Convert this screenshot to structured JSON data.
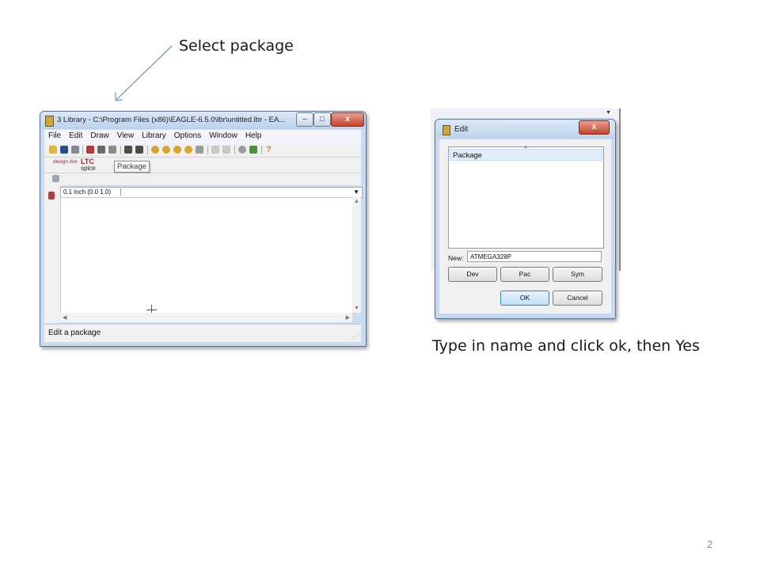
{
  "slide": {
    "caption_top": "Select package",
    "caption_right": "Type in name and click ok, then Yes",
    "page_number": "2"
  },
  "eagle_window": {
    "title": "3 Library - C:\\Program Files (x86)\\EAGLE-6.5.0\\lbr\\untitled.lbr - EA...",
    "controls": {
      "minimize": "–",
      "maximize": "□",
      "close": "x"
    },
    "menu": [
      "File",
      "Edit",
      "Draw",
      "View",
      "Library",
      "Options",
      "Window",
      "Help"
    ],
    "toolbar_logo_design": "design link",
    "toolbar_logo_ltc": "LTC",
    "toolbar_logo_ltc_sub": "spice",
    "tooltip": "Package",
    "grid_display": "0.1 inch (0.0 1.0)",
    "status": "Edit a package",
    "icon_names": [
      "open-icon",
      "save-icon",
      "print-icon",
      "cam-icon",
      "ulp-icon",
      "script-icon",
      "board-icon",
      "schematic-icon",
      "zoom-fit-icon",
      "zoom-in-icon",
      "zoom-out-icon",
      "zoom-select-icon",
      "redraw-icon",
      "undo-icon",
      "redo-icon",
      "stop-icon",
      "go-icon",
      "help-icon"
    ]
  },
  "edit_dialog": {
    "title": "Edit",
    "close": "x",
    "list_items": [
      "Package"
    ],
    "new_label": "New:",
    "new_value": "ATMEGA328P",
    "buttons": {
      "dev": "Dev",
      "pac": "Pac",
      "sym": "Sym",
      "ok": "OK",
      "cancel": "Cancel"
    }
  },
  "colors": {
    "window_frame": "#c9dcf0",
    "close_button": "#c4442b",
    "arrow": "#4f81bd",
    "selected_item": "#e1edf9"
  }
}
